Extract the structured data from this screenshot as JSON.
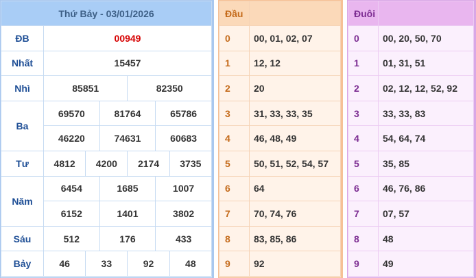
{
  "title": "Thứ Bảy - 03/01/2026",
  "prizes": {
    "db": {
      "label": "ĐB",
      "values": [
        "00949"
      ]
    },
    "nhat": {
      "label": "Nhất",
      "values": [
        "15457"
      ]
    },
    "nhi": {
      "label": "Nhì",
      "values": [
        "85851",
        "82350"
      ]
    },
    "ba": {
      "label": "Ba",
      "values": [
        "69570",
        "81764",
        "65786",
        "46220",
        "74631",
        "60683"
      ]
    },
    "tu": {
      "label": "Tư",
      "values": [
        "4812",
        "4200",
        "2174",
        "3735"
      ]
    },
    "nam": {
      "label": "Năm",
      "values": [
        "6454",
        "1685",
        "1007",
        "6152",
        "1401",
        "3802"
      ]
    },
    "sau": {
      "label": "Sáu",
      "values": [
        "512",
        "176",
        "433"
      ]
    },
    "bay": {
      "label": "Bảy",
      "values": [
        "46",
        "33",
        "92",
        "48"
      ]
    }
  },
  "dau": {
    "header": "Đầu",
    "rows": [
      {
        "digit": "0",
        "values": "00, 01, 02, 07"
      },
      {
        "digit": "1",
        "values": "12, 12"
      },
      {
        "digit": "2",
        "values": "20"
      },
      {
        "digit": "3",
        "values": "31, 33, 33, 35"
      },
      {
        "digit": "4",
        "values": "46, 48, 49"
      },
      {
        "digit": "5",
        "values": "50, 51, 52, 54, 57"
      },
      {
        "digit": "6",
        "values": "64"
      },
      {
        "digit": "7",
        "values": "70, 74, 76"
      },
      {
        "digit": "8",
        "values": "83, 85, 86"
      },
      {
        "digit": "9",
        "values": "92"
      }
    ]
  },
  "duoi": {
    "header": "Đuôi",
    "rows": [
      {
        "digit": "0",
        "values": "00, 20, 50, 70"
      },
      {
        "digit": "1",
        "values": "01, 31, 51"
      },
      {
        "digit": "2",
        "values": "02, 12, 12, 52, 92"
      },
      {
        "digit": "3",
        "values": "33, 33, 83"
      },
      {
        "digit": "4",
        "values": "54, 64, 74"
      },
      {
        "digit": "5",
        "values": "35, 85"
      },
      {
        "digit": "6",
        "values": "46, 76, 86"
      },
      {
        "digit": "7",
        "values": "07, 57"
      },
      {
        "digit": "8",
        "values": "48"
      },
      {
        "digit": "9",
        "values": "49"
      }
    ]
  }
}
